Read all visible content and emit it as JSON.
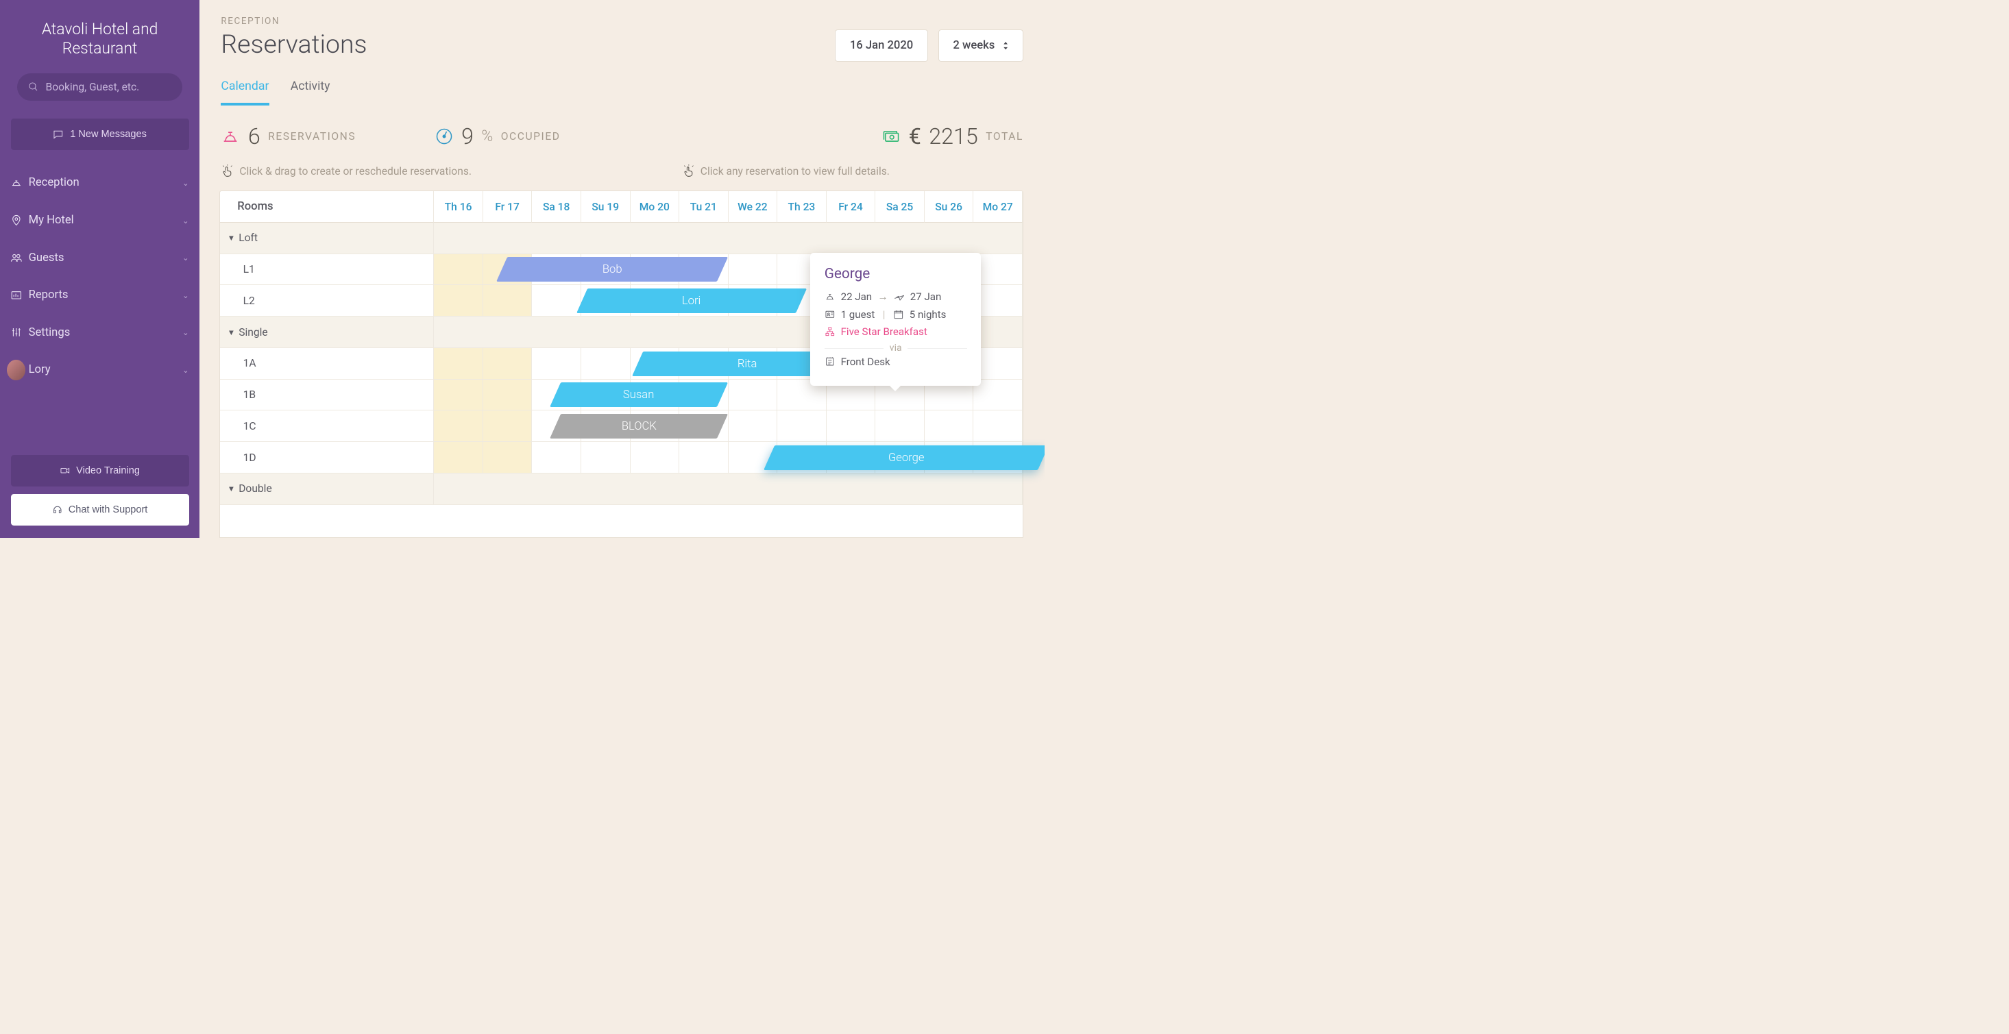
{
  "brand": "Atavoli Hotel and Restaurant",
  "search": {
    "placeholder": "Booking, Guest, etc."
  },
  "messages": {
    "label": "1 New Messages"
  },
  "nav": {
    "reception": "Reception",
    "myhotel": "My Hotel",
    "guests": "Guests",
    "reports": "Reports",
    "settings": "Settings",
    "user": "Lory"
  },
  "sidebar_footer": {
    "video": "Video Training",
    "chat": "Chat with Support"
  },
  "breadcrumb": "RECEPTION",
  "title": "Reservations",
  "date_picker": "16 Jan 2020",
  "range_picker": "2 weeks",
  "tabs": {
    "calendar": "Calendar",
    "activity": "Activity"
  },
  "stats": {
    "reservations_n": "6",
    "reservations_label": "RESERVATIONS",
    "occupied_n": "9",
    "occupied_pct": "%",
    "occupied_label": "OCCUPIED",
    "total_currency": "€",
    "total_n": "2215",
    "total_label": "TOTAL"
  },
  "hints": {
    "drag": "Click & drag to create or reschedule reservations.",
    "click": "Click any reservation to view full details."
  },
  "grid": {
    "rooms_header": "Rooms",
    "days": [
      "Th 16",
      "Fr 17",
      "Sa 18",
      "Su 19",
      "Mo 20",
      "Tu 21",
      "We 22",
      "Th 23",
      "Fr 24",
      "Sa 25",
      "Su 26",
      "Mo 27"
    ],
    "groups": {
      "loft": "Loft",
      "single": "Single",
      "double": "Double"
    },
    "rooms": {
      "l1": "L1",
      "l2": "L2",
      "a1": "1A",
      "b1": "1B",
      "c1": "1C",
      "d1": "1D"
    }
  },
  "bars": {
    "bob": "Bob",
    "lori": "Lori",
    "rita": "Rita",
    "susan": "Susan",
    "block": "BLOCK",
    "george": "George"
  },
  "popover": {
    "name": "George",
    "from": "22 Jan",
    "to": "27 Jan",
    "guests": "1 guest",
    "nights": "5 nights",
    "plan": "Five Star Breakfast",
    "via": "via",
    "source": "Front Desk"
  }
}
